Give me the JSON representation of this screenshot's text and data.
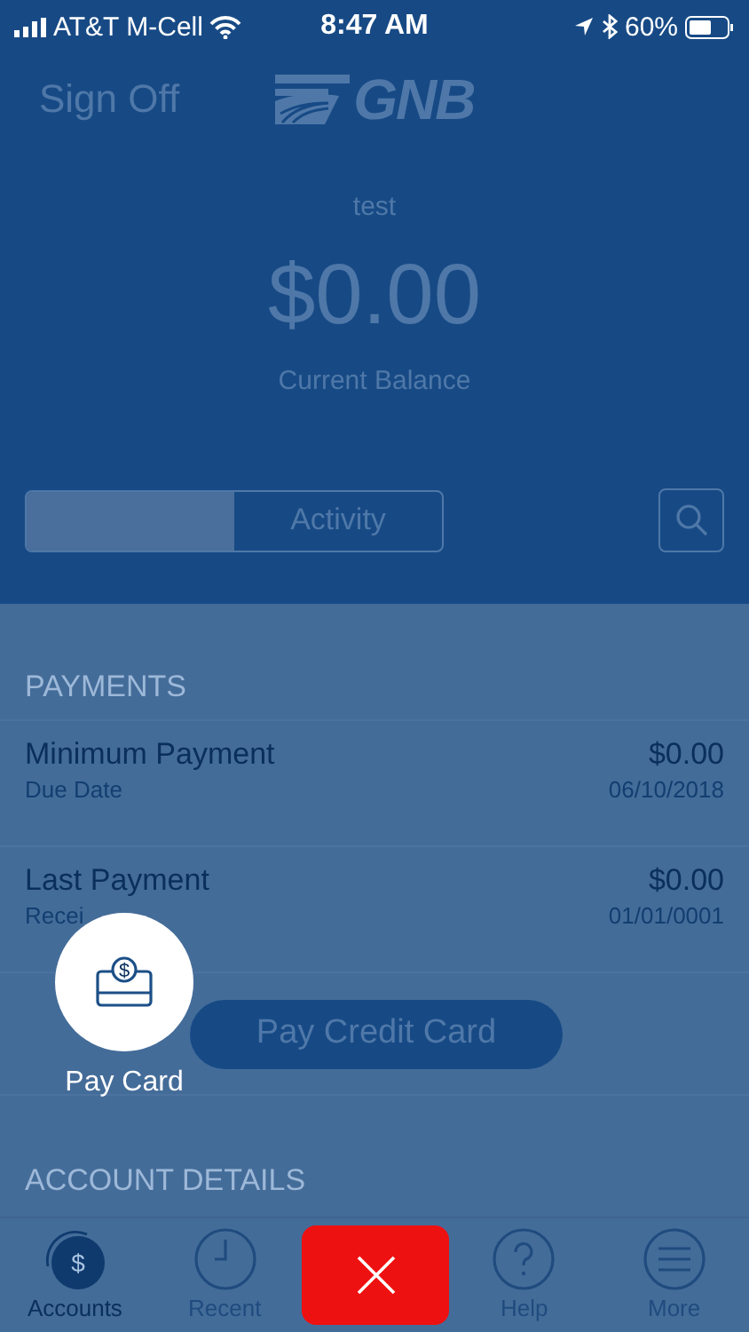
{
  "status_bar": {
    "carrier": "AT&T M-Cell",
    "time": "8:47 AM",
    "battery": "60%"
  },
  "header": {
    "sign_off": "Sign Off",
    "logo": "GNB",
    "account_name": "test",
    "balance": "$0.00",
    "balance_label": "Current Balance"
  },
  "segments": [
    {
      "selected": true
    },
    {
      "label": "Activity",
      "selected": false
    }
  ],
  "payments": {
    "title": "PAYMENTS",
    "rows": [
      {
        "label": "Minimum Payment",
        "sublabel": "Due Date",
        "amount": "$0.00",
        "date": "06/10/2018"
      },
      {
        "label": "Last Payment",
        "sublabel": "Recei",
        "amount": "$0.00",
        "date": "01/01/0001"
      }
    ],
    "button": "Pay Credit Card"
  },
  "account_details": {
    "title": "ACCOUNT DETAILS"
  },
  "tab_bar": [
    {
      "label": "Accounts",
      "kind": "accounts",
      "selected": true,
      "icon_text": "$"
    },
    {
      "label": "Recent",
      "kind": "recent",
      "selected": false
    },
    {
      "label": "Help",
      "kind": "help",
      "selected": false
    },
    {
      "label": "More",
      "kind": "more",
      "selected": false
    }
  ],
  "overlay": {
    "action": "Pay Card",
    "icon_text": "$"
  }
}
